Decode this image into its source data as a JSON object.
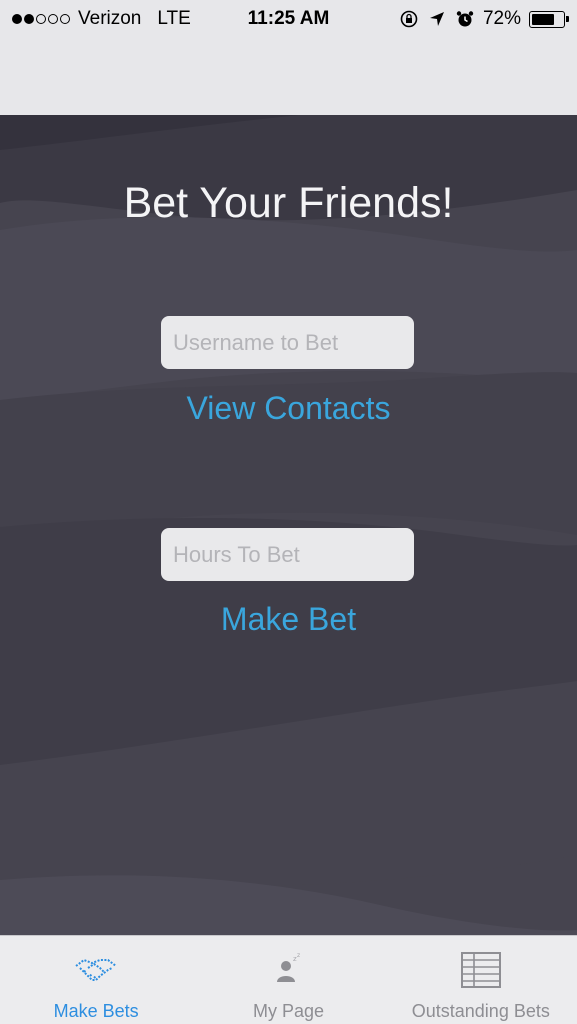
{
  "status_bar": {
    "carrier": "Verizon",
    "network": "LTE",
    "time": "11:25 AM",
    "battery": "72%",
    "battery_level": 0.72,
    "signal_bars_filled": 2,
    "signal_bars_total": 5
  },
  "main": {
    "title": "Bet Your Friends!",
    "username_field": {
      "placeholder": "Username to Bet",
      "value": ""
    },
    "view_contacts_label": "View Contacts",
    "hours_field": {
      "placeholder": "Hours To Bet",
      "value": ""
    },
    "make_bet_label": "Make Bet"
  },
  "tab_bar": {
    "tabs": [
      {
        "label": "Make Bets",
        "icon": "handshake-icon",
        "active": true
      },
      {
        "label": "My Page",
        "icon": "person-sleeping-icon",
        "active": false
      },
      {
        "label": "Outstanding Bets",
        "icon": "table-grid-icon",
        "active": false
      }
    ]
  },
  "colors": {
    "background": "#46444f",
    "accent": "#3aa6dd",
    "tab_active": "#2d8ee0",
    "tab_inactive": "#8e8e93",
    "title_text": "#f4f4f6"
  }
}
